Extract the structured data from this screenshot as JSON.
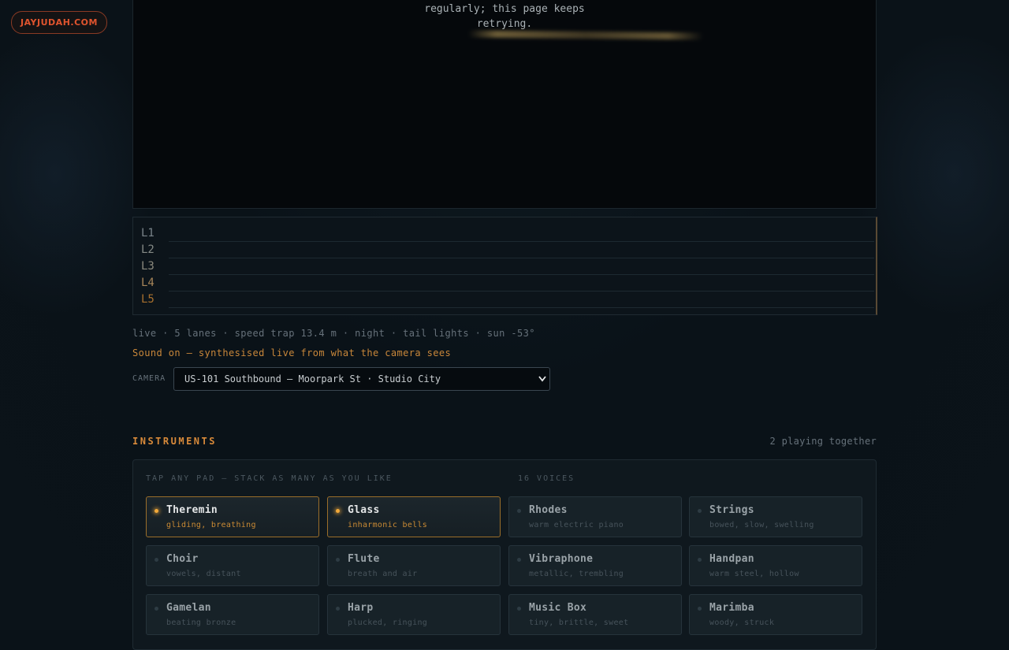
{
  "site": {
    "logo": "JAYJUDAH.COM"
  },
  "video": {
    "message_line1": "regularly; this page keeps",
    "message_line2": "retrying."
  },
  "lanes": [
    {
      "label": "L1",
      "color": "#7a848a"
    },
    {
      "label": "L2",
      "color": "#858a86"
    },
    {
      "label": "L3",
      "color": "#8c8a7e"
    },
    {
      "label": "L4",
      "color": "#a8865a"
    },
    {
      "label": "L5",
      "color": "#a8702e"
    }
  ],
  "status_line": "live · 5 lanes · speed trap 13.4 m · night · tail lights · sun -53°",
  "sound_line": "Sound on — synthesised live from what the camera sees",
  "camera": {
    "label": "CAMERA",
    "selected": "US-101 Southbound — Moorpark St · Studio City",
    "chevron_icon": "chevron-down-icon"
  },
  "instruments": {
    "title": "INSTRUMENTS",
    "playing_count": "2 playing together",
    "hint": "TAP ANY PAD — STACK AS MANY AS YOU LIKE",
    "voices": "16 VOICES",
    "accent": "#d98a3a",
    "pads": [
      {
        "name": "Theremin",
        "desc": "gliding, breathing",
        "active": true
      },
      {
        "name": "Glass",
        "desc": "inharmonic bells",
        "active": true
      },
      {
        "name": "Rhodes",
        "desc": "warm electric piano",
        "active": false
      },
      {
        "name": "Strings",
        "desc": "bowed, slow, swelling",
        "active": false
      },
      {
        "name": "Choir",
        "desc": "vowels, distant",
        "active": false
      },
      {
        "name": "Flute",
        "desc": "breath and air",
        "active": false
      },
      {
        "name": "Vibraphone",
        "desc": "metallic, trembling",
        "active": false
      },
      {
        "name": "Handpan",
        "desc": "warm steel, hollow",
        "active": false
      },
      {
        "name": "Gamelan",
        "desc": "beating bronze",
        "active": false
      },
      {
        "name": "Harp",
        "desc": "plucked, ringing",
        "active": false
      },
      {
        "name": "Music Box",
        "desc": "tiny, brittle, sweet",
        "active": false
      },
      {
        "name": "Marimba",
        "desc": "woody, struck",
        "active": false
      }
    ]
  }
}
